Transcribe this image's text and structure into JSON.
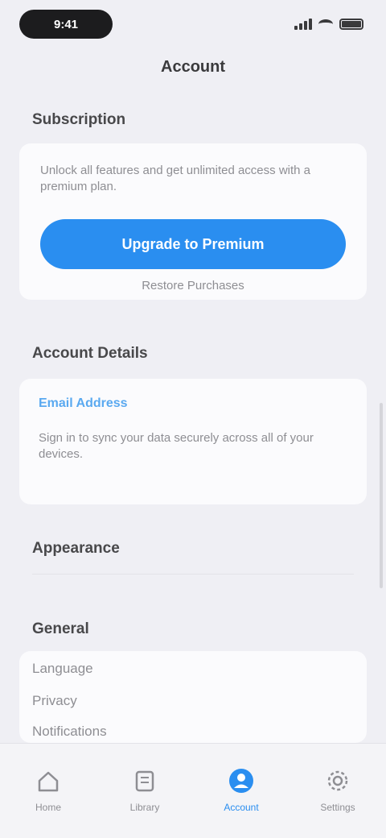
{
  "status_bar": {
    "time": "9:41"
  },
  "nav": {
    "title": "Account"
  },
  "subscription": {
    "header": "Subscription",
    "description": "Unlock all features and get unlimited access with a premium plan.",
    "primary_button": "Upgrade to Premium",
    "secondary_link": "Restore Purchases"
  },
  "account_details": {
    "header": "Account Details",
    "email_label": "Email Address",
    "description": "Sign in to sync your data securely across all of your devices."
  },
  "appearance": {
    "header": "Appearance"
  },
  "general": {
    "header": "General",
    "rows": [
      "Language",
      "Privacy",
      "Notifications"
    ]
  },
  "tabs": [
    {
      "label": "Home",
      "icon": "home-icon"
    },
    {
      "label": "Library",
      "icon": "library-icon"
    },
    {
      "label": "Account",
      "icon": "account-icon"
    },
    {
      "label": "Settings",
      "icon": "settings-icon"
    }
  ],
  "colors": {
    "accent": "#2a8ef0",
    "background": "#efeff4"
  }
}
